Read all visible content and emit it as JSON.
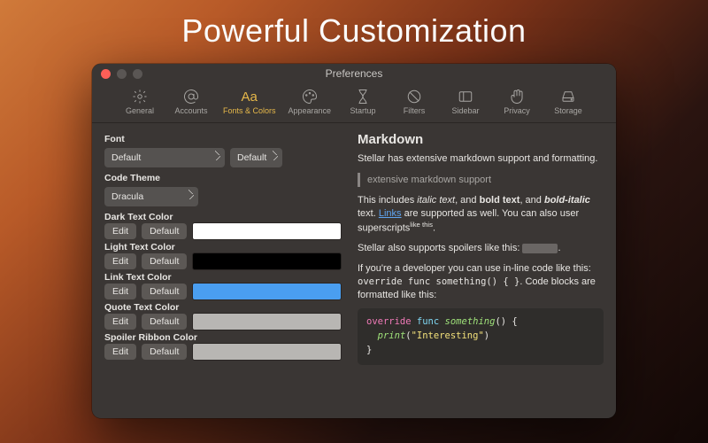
{
  "marketing_title": "Powerful Customization",
  "window_title": "Preferences",
  "toolbar": [
    {
      "id": "general",
      "label": "General"
    },
    {
      "id": "accounts",
      "label": "Accounts"
    },
    {
      "id": "fonts-colors",
      "label": "Fonts & Colors",
      "active": true
    },
    {
      "id": "appearance",
      "label": "Appearance"
    },
    {
      "id": "startup",
      "label": "Startup"
    },
    {
      "id": "filters",
      "label": "Filters"
    },
    {
      "id": "sidebar",
      "label": "Sidebar"
    },
    {
      "id": "privacy",
      "label": "Privacy"
    },
    {
      "id": "storage",
      "label": "Storage"
    }
  ],
  "left_panel": {
    "font_label": "Font",
    "font_family_value": "Default",
    "font_size_value": "Default",
    "code_theme_label": "Code Theme",
    "code_theme_value": "Dracula",
    "color_rows": [
      {
        "label": "Dark Text Color",
        "swatch": "#ffffff"
      },
      {
        "label": "Light Text Color",
        "swatch": "#000000"
      },
      {
        "label": "Link Text Color",
        "swatch": "#4a9ef0"
      },
      {
        "label": "Quote Text Color",
        "swatch": "#b8b6b3"
      },
      {
        "label": "Spoiler Ribbon Color",
        "swatch": "#b8b6b3"
      }
    ],
    "edit_label": "Edit",
    "default_label": "Default"
  },
  "right_panel": {
    "heading": "Markdown",
    "intro": "Stellar has extensive markdown support and formatting.",
    "blockquote": "extensive markdown support",
    "formats_prefix": "This includes ",
    "italic": "italic text",
    "sep1": ", and ",
    "bold": "bold text",
    "sep2": ", and ",
    "bolditalic": "bold-italic",
    "formats_suffix": " text. ",
    "link_text": "Links",
    "after_link": " are supported as well. You can also user superscripts",
    "sup": "like this",
    "period": ".",
    "spoiler_line": "Stellar also supports spoilers like this: ",
    "dev_line_1": "If you're a developer you can use in-line code like this: ",
    "inline_code": "override func something() { }",
    "dev_line_2": ". Code blocks are formatted like this:",
    "code": {
      "l1_kw": "override",
      "l1_kw2": "func",
      "l1_fn": "something",
      "l1_rest": "() {",
      "l2_fn": "print",
      "l2_str": "\"Interesting\"",
      "l3": "}"
    }
  }
}
